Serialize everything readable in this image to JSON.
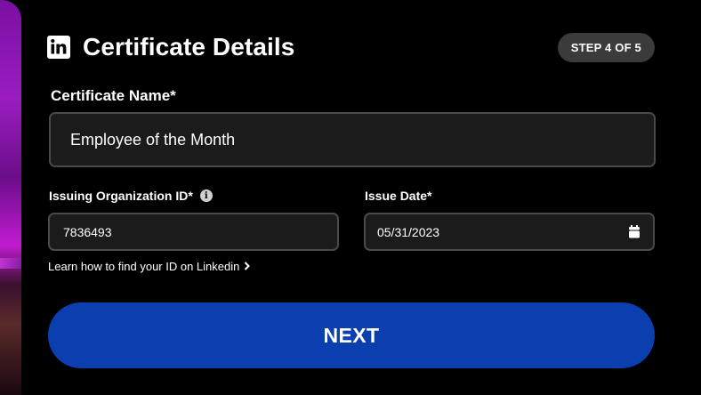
{
  "header": {
    "title": "Certificate Details",
    "step": "STEP 4 OF 5",
    "logo_icon": "linkedin-icon"
  },
  "form": {
    "certificate_name": {
      "label": "Certificate Name*",
      "value": "Employee of the Month"
    },
    "organization_id": {
      "label": "Issuing Organization ID*",
      "value": "7836493",
      "info_icon": "info-icon"
    },
    "issue_date": {
      "label": "Issue Date*",
      "value": "05/31/2023",
      "icon": "calendar-icon"
    },
    "help_link": "Learn how to find your ID on Linkedin",
    "help_link_icon": "chevron-right-icon"
  },
  "actions": {
    "next_label": "NEXT"
  },
  "colors": {
    "background": "#000000",
    "input_bg": "#1b1b1b",
    "input_border": "#4a4a4a",
    "badge_bg": "#3b3b3b",
    "primary_button": "#0b3fb0"
  }
}
